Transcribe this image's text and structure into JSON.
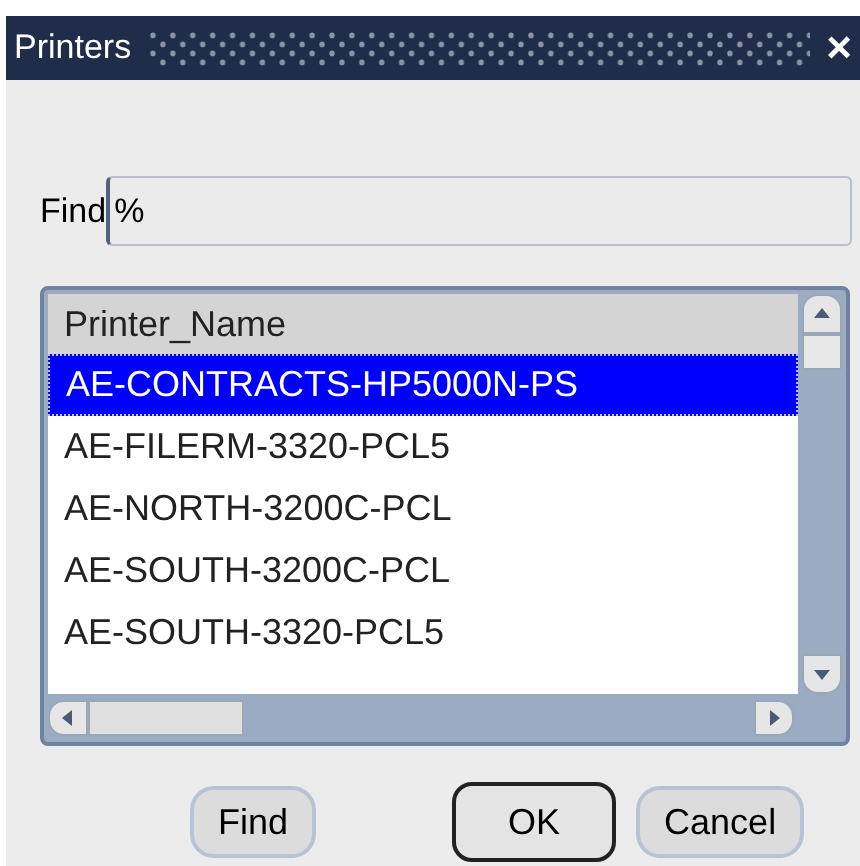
{
  "window": {
    "title": "Printers",
    "close": "×"
  },
  "find": {
    "label": "Find",
    "value": "%"
  },
  "list": {
    "column": "Printer_Name",
    "rows": [
      {
        "name": "AE-CONTRACTS-HP5000N-PS",
        "selected": true
      },
      {
        "name": "AE-FILERM-3320-PCL5",
        "selected": false
      },
      {
        "name": "AE-NORTH-3200C-PCL",
        "selected": false
      },
      {
        "name": "AE-SOUTH-3200C-PCL",
        "selected": false
      },
      {
        "name": "AE-SOUTH-3320-PCL5",
        "selected": false
      }
    ]
  },
  "buttons": [
    {
      "label": "Find",
      "default": false
    },
    {
      "label": "OK",
      "default": true
    },
    {
      "label": "Cancel",
      "default": false
    }
  ]
}
